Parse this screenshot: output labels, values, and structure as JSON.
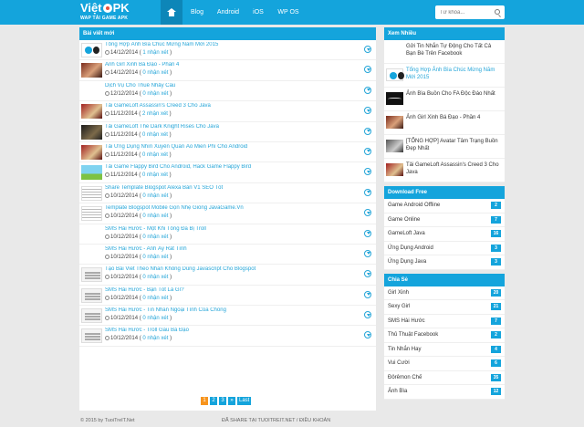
{
  "header": {
    "logo_main_left": "Việt",
    "logo_main_right": "PK",
    "logo_sub": "WAP TẢI GAME APK",
    "nav": [
      "Blog",
      "Android",
      "iOS",
      "WP OS"
    ],
    "search_placeholder": "Từ khóa..."
  },
  "main": {
    "heading": "Bài viết mới",
    "posts": [
      {
        "title": "Tổng Hợp Ảnh Bìa Chúc Mừng Năm Mới 2015",
        "date": "14/12/2014",
        "comments": "1 nhận xét",
        "thumb": "t-logo"
      },
      {
        "title": "Ảnh Girl Xinh Bá Đạo - Phần 4",
        "date": "14/12/2014",
        "comments": "0 nhận xét",
        "thumb": "t-girl"
      },
      {
        "title": "Dịch Vụ Cho Thuê Nhảy Cầu",
        "date": "12/12/2014",
        "comments": "0 nhận xét",
        "thumb": "t-plain"
      },
      {
        "title": "Tải GameLoft Assassin's Creed 3 Cho Java",
        "date": "11/12/2014",
        "comments": "2 nhận xét",
        "thumb": "t-red"
      },
      {
        "title": "Tải GameLoft The Dark Knight Rises Cho Java",
        "date": "11/12/2014",
        "comments": "0 nhận xét",
        "thumb": "t-dark"
      },
      {
        "title": "Tải Ứng Dụng Nhìn Xuyên Quần Áo Miễn Phí Cho Android",
        "date": "11/12/2014",
        "comments": "0 nhận xét",
        "thumb": "t-red"
      },
      {
        "title": "Tải Game Flappy Bird Cho Android, Hack Game Flappy Bird",
        "date": "11/12/2014",
        "comments": "0 nhận xét",
        "thumb": "t-flappy"
      },
      {
        "title": "Share Template Blogspot Alexa Bán V1 SEO Tốt",
        "date": "10/12/2014",
        "comments": "0 nhận xét",
        "thumb": "t-doc"
      },
      {
        "title": "Template Blogspot Mobile Gọn Nhẹ Giống JavaGame.Vn",
        "date": "10/12/2014",
        "comments": "0 nhận xét",
        "thumb": "t-doc"
      },
      {
        "title": "SMS Hài Hước - Một Khi Tông Đã Bị Troll",
        "date": "10/12/2014",
        "comments": "0 nhận xét",
        "thumb": "t-plain"
      },
      {
        "title": "SMS Hài Hước - Anh Ấy Rất Tình",
        "date": "10/12/2014",
        "comments": "0 nhận xét",
        "thumb": "t-plain"
      },
      {
        "title": "Tạo Bài Viết Theo Nhãn Không Dùng Javascript Cho Blogspot",
        "date": "10/12/2014",
        "comments": "0 nhận xét",
        "thumb": "t-sms"
      },
      {
        "title": "SMS Hài Hước - Bạn Tốt Là Gì?",
        "date": "10/12/2014",
        "comments": "0 nhận xét",
        "thumb": "t-sms"
      },
      {
        "title": "SMS Hài Hước - Tin Nhắn Ngoại Tình Của Chồng",
        "date": "10/12/2014",
        "comments": "0 nhận xét",
        "thumb": "t-sms"
      },
      {
        "title": "SMS Hài Hước - Troll Gấu Bá Đạo",
        "date": "10/12/2014",
        "comments": "0 nhận xét",
        "thumb": "t-sms"
      }
    ],
    "pagination": [
      "1",
      "2",
      "3",
      "»",
      "Last"
    ]
  },
  "sidebar": {
    "popular_heading": "Xem Nhiều",
    "popular": [
      {
        "title": "Gửi Tin Nhắn Tự Động Cho Tất Cả Bạn Bè Trên Facebook",
        "thumb": "t-plain",
        "blue": false
      },
      {
        "title": "Tổng Hợp Ảnh Bìa Chúc Mừng Năm Mới 2015",
        "thumb": "t-logo",
        "blue": true
      },
      {
        "title": "Ảnh Bìa Buồn Cho FA Độc Đáo Nhất",
        "thumb": "t-wave",
        "blue": false
      },
      {
        "title": "Ảnh Girl Xinh Bá Đạo - Phần 4",
        "thumb": "t-girl",
        "blue": false
      },
      {
        "title": "[TỔNG HỢP] Avatar Tâm Trạng Buồn Đẹp Nhất",
        "thumb": "t-gray",
        "blue": false
      },
      {
        "title": "Tải GameLoft Assassin's Creed 3 Cho Java",
        "thumb": "t-red",
        "blue": false
      }
    ],
    "download_heading": "Download Free",
    "downloads": [
      {
        "name": "Game Android Offline",
        "count": "2"
      },
      {
        "name": "Game Online",
        "count": "7"
      },
      {
        "name": "GameLoft Java",
        "count": "16"
      },
      {
        "name": "Ứng Dụng Android",
        "count": "3"
      },
      {
        "name": "Ứng Dụng Java",
        "count": "3"
      }
    ],
    "share_heading": "Chia Sẻ",
    "shares": [
      {
        "name": "Girl Xinh",
        "count": "20"
      },
      {
        "name": "Sexy Girl",
        "count": "21"
      },
      {
        "name": "SMS Hài Hước",
        "count": "7"
      },
      {
        "name": "Thủ Thuật Facebook",
        "count": "2"
      },
      {
        "name": "Tin Nhắn Hay",
        "count": "4"
      },
      {
        "name": "Vui Cười",
        "count": "6"
      },
      {
        "name": "Đôrêmon Chế",
        "count": "35"
      },
      {
        "name": "Ảnh Bìa",
        "count": "12"
      }
    ]
  },
  "footer": {
    "left": "© 2015 by TuoiTreIT.Net",
    "right": "ĐÃ SHARE TẠI TUOITREIT.NET / ĐIỀU KHOẢN"
  },
  "colors": {
    "primary": "#14a4dc",
    "accent": "#f7941d",
    "link": "#24a5d8",
    "background": "#e9e9e9"
  }
}
